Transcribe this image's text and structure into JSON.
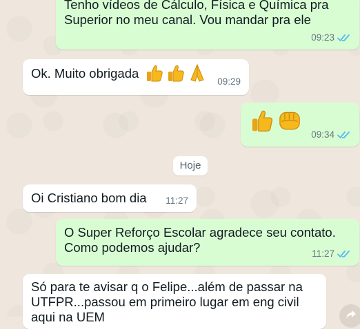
{
  "colors": {
    "incoming_bg": "#ffffff",
    "outgoing_bg": "#d9fdd3",
    "read_tick": "#53bdeb",
    "timestamp": "#667781",
    "wallpaper": "#efe7dd"
  },
  "messages": [
    {
      "direction": "outgoing",
      "text": "Tenho vídeos de Cálculo, Física e Química pra\nSuperior no meu canal. Vou mandar pra ele",
      "time": "09:23",
      "status_icon": "double-check-read-icon"
    },
    {
      "direction": "incoming",
      "text": "Ok. Muito obrigada",
      "emojis": [
        "thumbs-up",
        "thumbs-up",
        "folded-hands"
      ],
      "time": "09:29"
    },
    {
      "direction": "outgoing",
      "text": "",
      "emojis": [
        "thumbs-up",
        "oncoming-fist"
      ],
      "time": "09:34",
      "status_icon": "double-check-read-icon"
    },
    {
      "direction": "incoming",
      "text": "Oi Cristiano bom dia",
      "time": "11:27"
    },
    {
      "direction": "outgoing",
      "text": "O Super Reforço Escolar agradece seu contato.\nComo podemos ajudar?",
      "time": "11:27",
      "status_icon": "double-check-read-icon"
    },
    {
      "direction": "incoming",
      "text": "Só para te avisar q o Felipe...além de passar na\nUTFPR...passou em primeiro lugar em eng civil\naqui na UEM"
    }
  ],
  "day_separator": "Hoje"
}
